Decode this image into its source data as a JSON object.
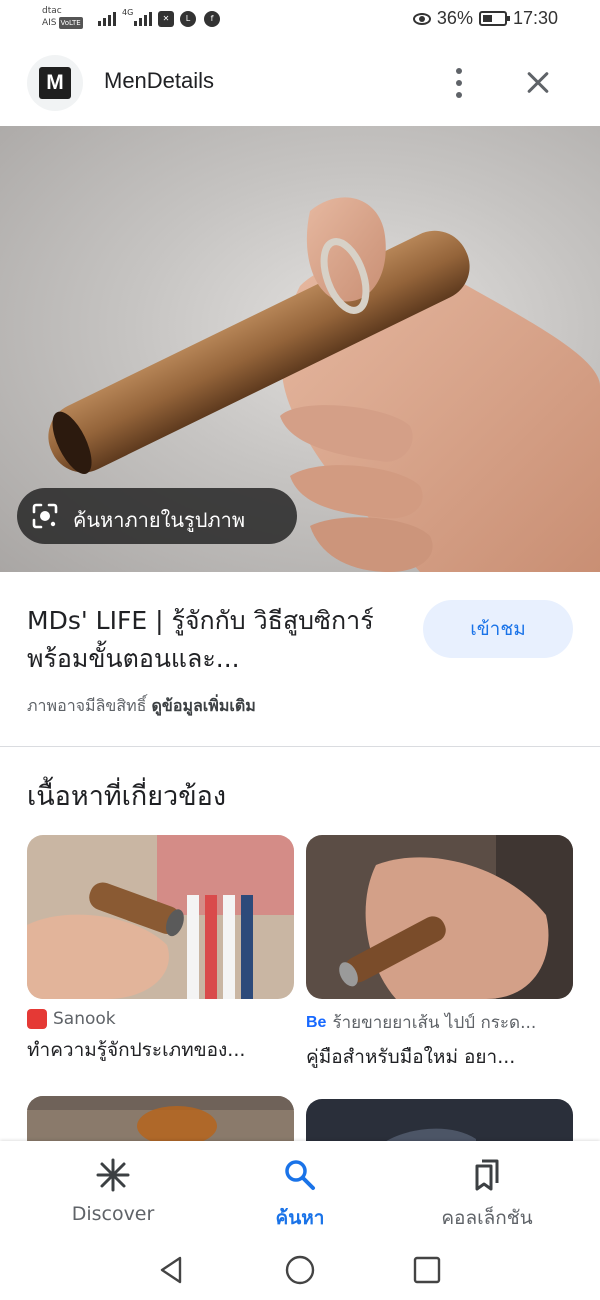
{
  "status_bar": {
    "carrier_top": "dtac",
    "carrier_bottom": "AIS",
    "volte": "VoLTE",
    "network": "4G",
    "battery": "36%",
    "time": "17:30"
  },
  "header": {
    "logo_letter": "M",
    "site_name": "MenDetails"
  },
  "hero": {
    "lens_label": "ค้นหาภายในรูปภาพ"
  },
  "result": {
    "title": "MDs' LIFE | รู้จักกับ วิธีสูบซิการ์ พร้อมขั้นตอนและ...",
    "visit_label": "เข้าชม",
    "copyright_note": "ภาพอาจมีลิขสิทธิ์",
    "more_info": "ดูข้อมูลเพิ่มเติม"
  },
  "related": {
    "heading": "เนื้อหาที่เกี่ยวข้อง",
    "cards": [
      {
        "source": "Sanook",
        "title": "ทำความรู้จักประเภทของ...",
        "favicon": "sanook-icon",
        "favicon_color": "#e53935"
      },
      {
        "source": "ร้ายขายยาเส้น ไปป์ กระด...",
        "title": "คู่มือสำหรับมือใหม่ อยา...",
        "favicon": "behance-icon",
        "favicon_color": "#1769ff",
        "favicon_text": "Be"
      }
    ]
  },
  "bottom_nav": [
    {
      "label": "Discover",
      "icon": "discover-icon",
      "active": false
    },
    {
      "label": "ค้นหา",
      "icon": "search-icon",
      "active": true
    },
    {
      "label": "คอลเล็กชัน",
      "icon": "collections-icon",
      "active": false
    }
  ],
  "colors": {
    "accent": "#1a73e8",
    "accent_bg": "#e8f0fe",
    "text": "#202124",
    "muted": "#5f6368"
  }
}
